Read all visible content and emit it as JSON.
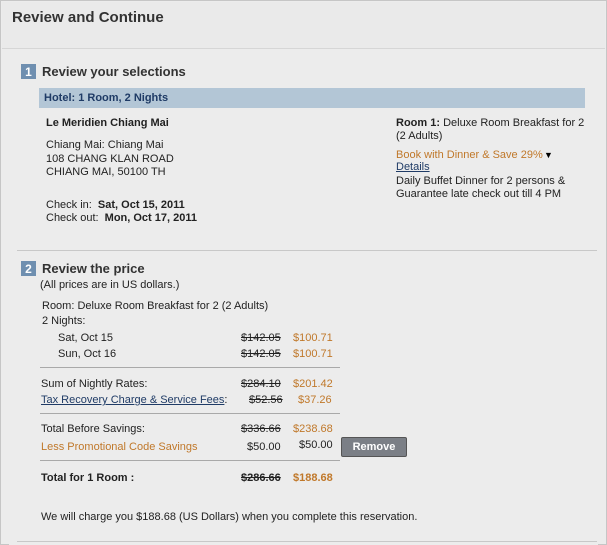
{
  "header": {
    "title": "Review and Continue"
  },
  "section1": {
    "number": "1",
    "title": "Review your selections",
    "hotel_bar": "Hotel: 1 Room, 2 Nights",
    "hotel_name": "Le Meridien Chiang Mai",
    "address_line1": "Chiang Mai: Chiang Mai",
    "address_line2": "108 CHANG KLAN ROAD",
    "address_line3": "CHIANG MAI, 50100 TH",
    "checkin_label": "Check in:",
    "checkin_value": "Sat, Oct 15, 2011",
    "checkout_label": "Check out:",
    "checkout_value": "Mon, Oct 17, 2011",
    "room_label": "Room 1:",
    "room_desc_line1": "Deluxe Room Breakfast for 2",
    "room_desc_line2": "(2 Adults)",
    "promo_text": "Book with Dinner & Save 29%",
    "details_link": "Details",
    "promo_desc_line1": "Daily Buffet Dinner for 2 persons &",
    "promo_desc_line2": "Guarantee late check out till 4 PM"
  },
  "section2": {
    "number": "2",
    "title": "Review the price",
    "note": "(All prices are in US dollars.)",
    "room_line": "Room: Deluxe Room Breakfast for 2  (2 Adults)",
    "nights_label": "2 Nights:",
    "nights": [
      {
        "date": "Sat, Oct 15",
        "orig": "$142.05",
        "price": "$100.71"
      },
      {
        "date": "Sun, Oct 16",
        "orig": "$142.05",
        "price": "$100.71"
      }
    ],
    "sum_label": "Sum of Nightly Rates:",
    "sum_orig": "$284.10",
    "sum_price": "$201.42",
    "tax_label": "Tax Recovery Charge & Service Fees",
    "tax_colon": ":",
    "tax_orig": "$52.56",
    "tax_price": "$37.26",
    "tbs_label": "Total Before Savings:",
    "tbs_orig": "$336.66",
    "tbs_price": "$238.68",
    "promo_label": "Less Promotional Code Savings",
    "promo_orig": "$50.00",
    "promo_price": "$50.00",
    "remove_label": "Remove",
    "total_label": "Total for 1 Room :",
    "total_orig": "$286.66",
    "total_price": "$188.68",
    "charge_note": "We will charge you $188.68 (US Dollars) when you complete this reservation."
  }
}
